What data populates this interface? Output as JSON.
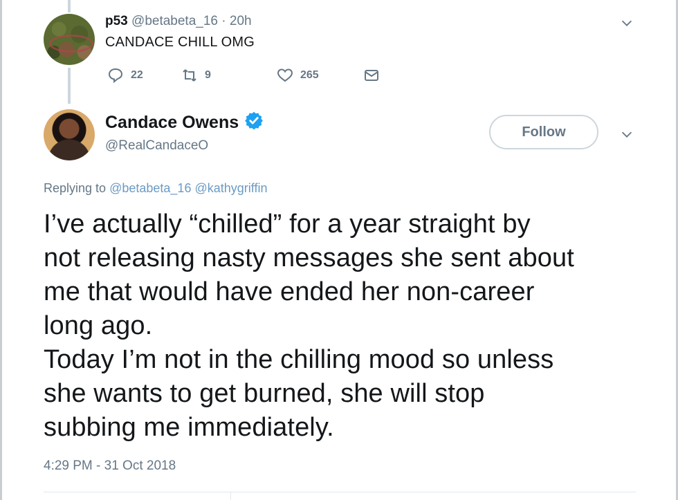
{
  "reply_tweet": {
    "display_name": "p53",
    "handle": "@betabeta_16",
    "separator": "·",
    "age": "20h",
    "text": "CANDACE CHILL OMG",
    "stats": {
      "replies": "22",
      "retweets": "9",
      "likes": "265"
    }
  },
  "main_tweet": {
    "display_name": "Candace Owens",
    "handle": "@RealCandaceO",
    "follow_label": "Follow",
    "replying_prefix": "Replying to",
    "replying_to": [
      "@betabeta_16",
      "@kathygriffin"
    ],
    "body": "I’ve actually “chilled” for a year straight by\nnot releasing nasty messages she sent about\nme that would have ended her non-career\nlong ago.\nToday I’m not in the chilling mood so unless\nshe wants to get burned, she will stop\nsubbing me immediately.",
    "timestamp": "4:29 PM - 31 Oct 2018"
  },
  "colors": {
    "link": "#6b9ac4",
    "verified": "#1da1f2",
    "muted": "#657786"
  },
  "icons": {
    "reply": "reply-icon",
    "retweet": "retweet-icon",
    "like": "heart-icon",
    "dm": "envelope-icon",
    "more": "chevron-down-icon",
    "verified": "verified-badge-icon"
  }
}
